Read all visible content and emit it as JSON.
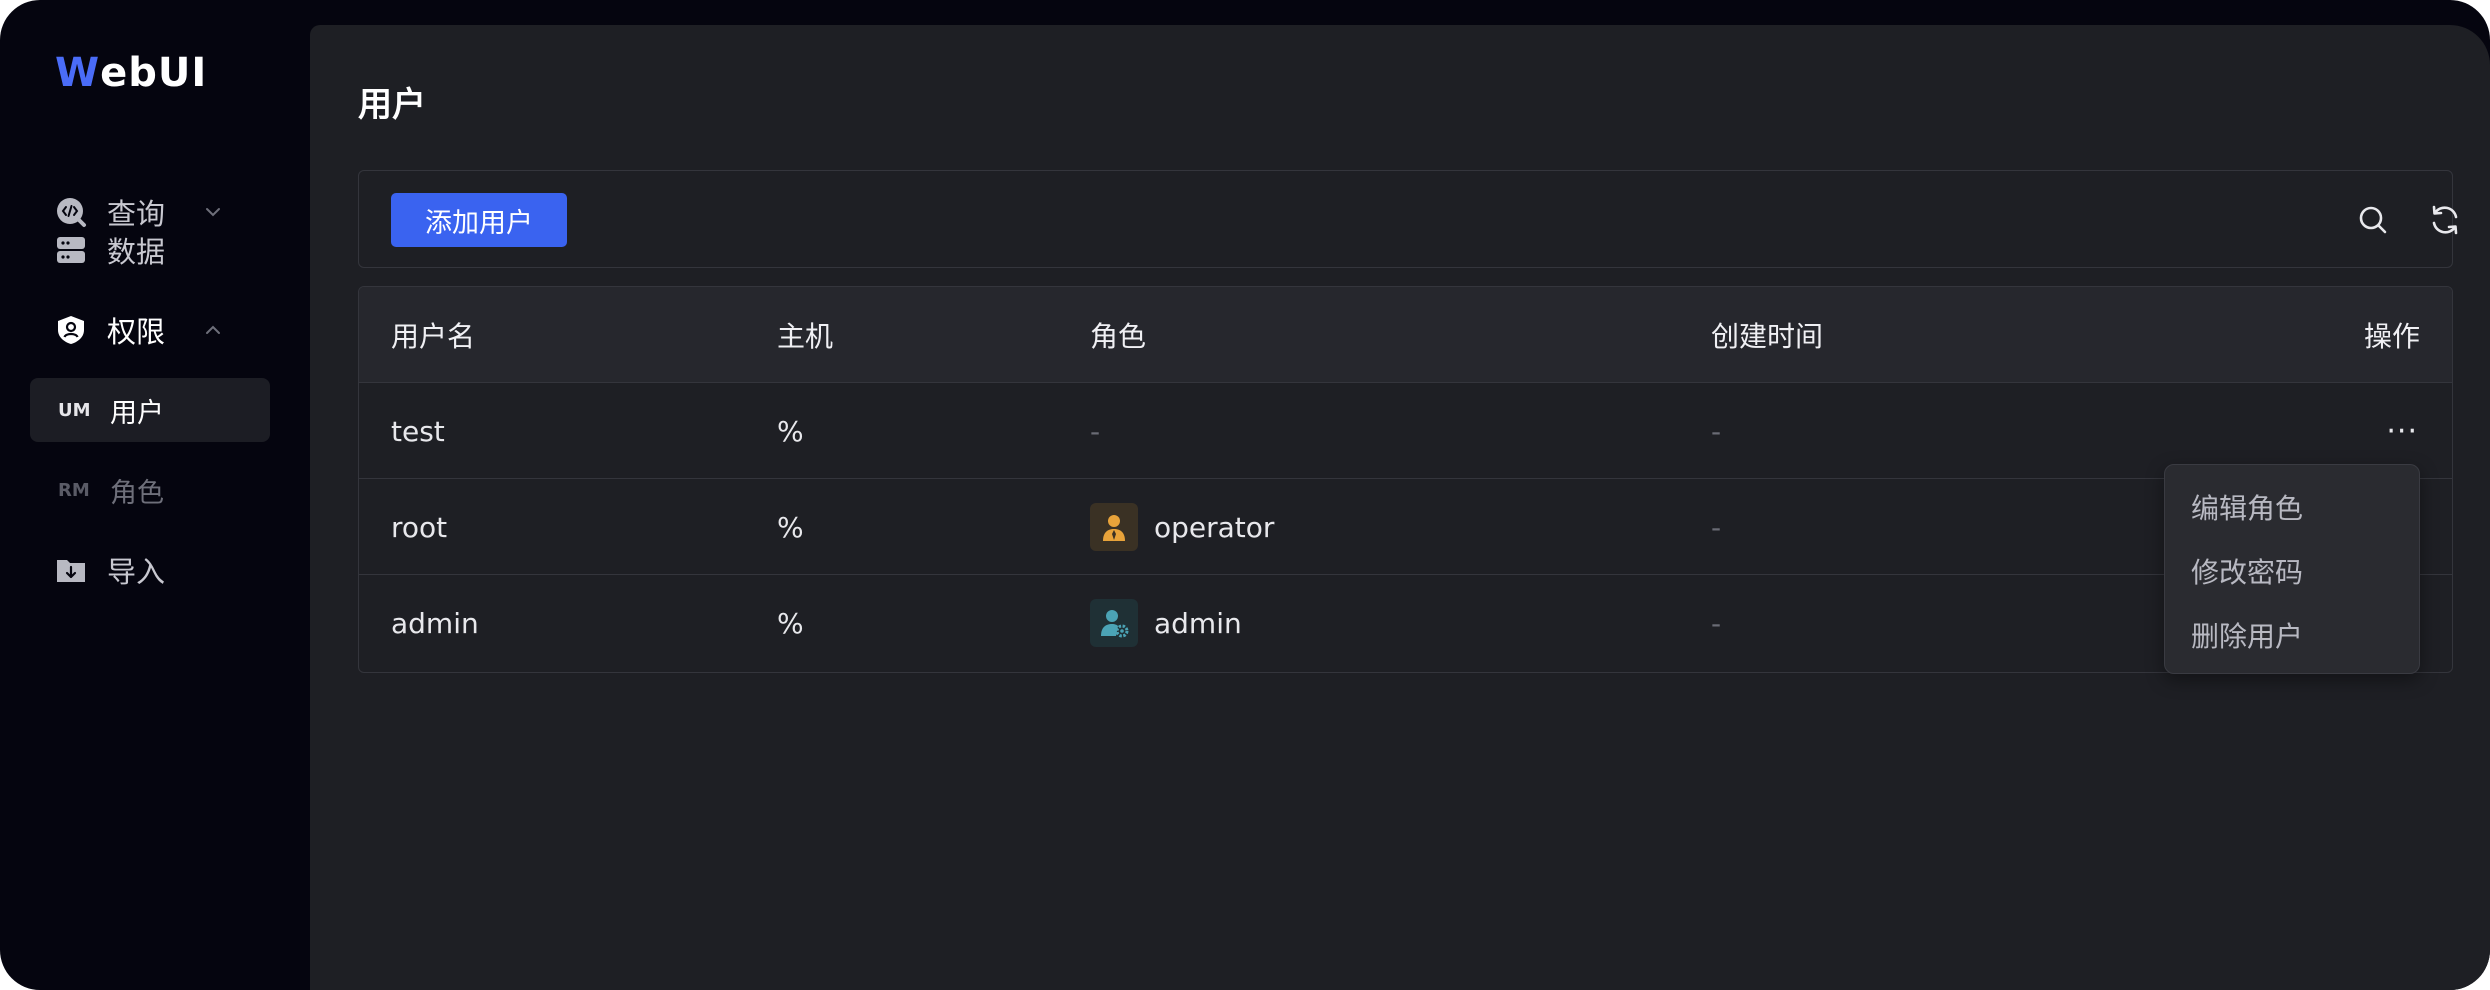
{
  "app": {
    "logo_w": "W",
    "logo_rest": "ebUI"
  },
  "sidebar": {
    "items": [
      {
        "label": "查询",
        "icon": "code-query-icon",
        "expanded": false
      },
      {
        "label": "数据",
        "icon": "database-icon"
      },
      {
        "label": "权限",
        "icon": "shield-user-icon",
        "expanded": true
      },
      {
        "label": "导入",
        "icon": "folder-import-icon"
      }
    ],
    "sub_items": [
      {
        "abbr": "UM",
        "label": "用户",
        "active": true
      },
      {
        "abbr": "RM",
        "label": "角色",
        "active": false
      }
    ]
  },
  "page": {
    "title": "用户"
  },
  "toolbar": {
    "add_label": "添加用户",
    "search_icon": "search-icon",
    "refresh_icon": "refresh-icon"
  },
  "table": {
    "columns": [
      "用户名",
      "主机",
      "角色",
      "创建时间",
      "操作"
    ],
    "rows": [
      {
        "username": "test",
        "host": "%",
        "role": "-",
        "created": "-",
        "action": "···"
      },
      {
        "username": "root",
        "host": "%",
        "role": "operator",
        "created": "-"
      },
      {
        "username": "admin",
        "host": "%",
        "role": "admin",
        "created": "-"
      }
    ]
  },
  "dropdown": {
    "items": [
      "编辑角色",
      "修改密码",
      "删除用户"
    ]
  },
  "colors": {
    "accent": "#3a63f0",
    "sidebar_bg": "#05050f",
    "panel_bg": "#1e1f24",
    "operator_icon": "#e8a33a",
    "admin_icon": "#4ba3b5"
  }
}
